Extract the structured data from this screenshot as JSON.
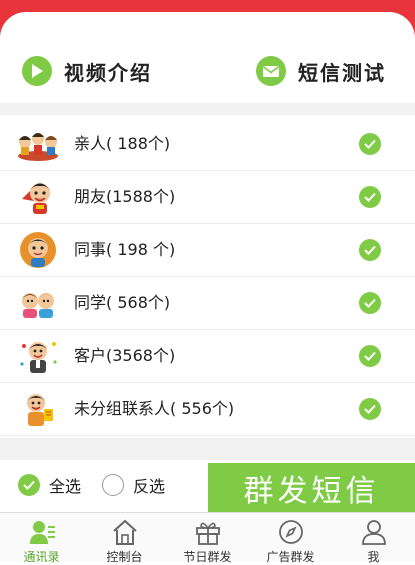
{
  "actions": {
    "video_label": "视频介绍",
    "sms_label": "短信测试"
  },
  "groups": [
    {
      "label": "亲人( 188个)",
      "checked": true
    },
    {
      "label": "朋友(1588个)",
      "checked": true
    },
    {
      "label": "同事( 198 个)",
      "checked": true
    },
    {
      "label": "同学( 568个)",
      "checked": true
    },
    {
      "label": "客户(3568个)",
      "checked": true
    },
    {
      "label": "未分组联系人( 556个)",
      "checked": true
    }
  ],
  "selection": {
    "select_all_label": "全选",
    "select_all_checked": true,
    "invert_label": "反选",
    "invert_checked": false
  },
  "send_button_label": "群发短信",
  "tabs": [
    {
      "label": "通讯录",
      "icon": "contacts-icon",
      "active": true
    },
    {
      "label": "控制台",
      "icon": "house-icon",
      "active": false
    },
    {
      "label": "节日群发",
      "icon": "gift-icon",
      "active": false
    },
    {
      "label": "广告群发",
      "icon": "compass-icon",
      "active": false
    },
    {
      "label": "我",
      "icon": "person-icon",
      "active": false
    }
  ],
  "colors": {
    "accent_green": "#7fcb45",
    "header_red": "#e8353b",
    "active_tab": "#5aa52c"
  }
}
